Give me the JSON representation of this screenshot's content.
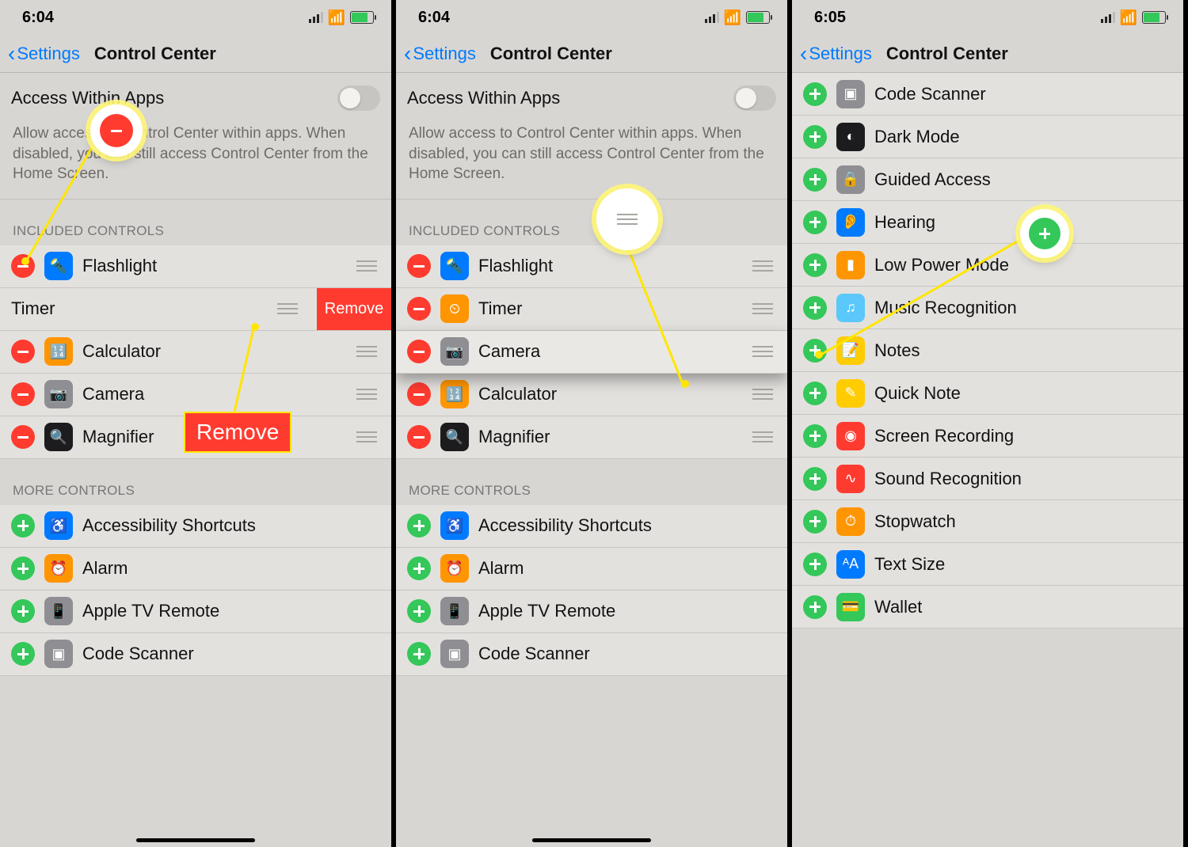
{
  "status": {
    "time_a": "6:04",
    "time_b": "6:04",
    "time_c": "6:05"
  },
  "nav": {
    "back": "Settings",
    "title": "Control Center"
  },
  "access": {
    "label": "Access Within Apps",
    "desc": "Allow access to Control Center within apps. When disabled, you can still access Control Center from the Home Screen."
  },
  "sections": {
    "included": "INCLUDED CONTROLS",
    "more": "MORE CONTROLS"
  },
  "phone1": {
    "included": [
      {
        "label": "Flashlight"
      },
      {
        "label": "Timer",
        "swiped": true,
        "remove": "Remove"
      },
      {
        "label": "Calculator"
      },
      {
        "label": "Camera"
      },
      {
        "label": "Magnifier"
      }
    ],
    "more": [
      {
        "label": "Accessibility Shortcuts"
      },
      {
        "label": "Alarm"
      },
      {
        "label": "Apple TV Remote"
      },
      {
        "label": "Code Scanner"
      }
    ],
    "callout_tag": "Remove"
  },
  "phone2": {
    "included": [
      {
        "label": "Flashlight"
      },
      {
        "label": "Timer"
      },
      {
        "label": "Camera",
        "dragging": true
      },
      {
        "label": "Calculator"
      },
      {
        "label": "Magnifier"
      }
    ],
    "more": [
      {
        "label": "Accessibility Shortcuts"
      },
      {
        "label": "Alarm"
      },
      {
        "label": "Apple TV Remote"
      },
      {
        "label": "Code Scanner"
      }
    ]
  },
  "phone3": {
    "more": [
      {
        "label": "Code Scanner"
      },
      {
        "label": "Dark Mode"
      },
      {
        "label": "Guided Access"
      },
      {
        "label": "Hearing"
      },
      {
        "label": "Low Power Mode"
      },
      {
        "label": "Music Recognition"
      },
      {
        "label": "Notes"
      },
      {
        "label": "Quick Note"
      },
      {
        "label": "Screen Recording"
      },
      {
        "label": "Sound Recognition"
      },
      {
        "label": "Stopwatch"
      },
      {
        "label": "Text Size"
      },
      {
        "label": "Wallet"
      }
    ]
  },
  "icons": {
    "Flashlight": {
      "glyph": "⚡",
      "bg": "bg-blue"
    },
    "Timer": {
      "glyph": "◷",
      "bg": "bg-orange"
    },
    "Calculator": {
      "glyph": "▦",
      "bg": "bg-orange"
    },
    "Camera": {
      "glyph": "◉",
      "bg": "bg-gray"
    },
    "Magnifier": {
      "glyph": "⌕",
      "bg": "bg-dark"
    },
    "Accessibility Shortcuts": {
      "glyph": "⦿",
      "bg": "bg-blue"
    },
    "Alarm": {
      "glyph": "⏰",
      "bg": "bg-orange"
    },
    "Apple TV Remote": {
      "glyph": "▭",
      "bg": "bg-gray"
    },
    "Code Scanner": {
      "glyph": "▣",
      "bg": "bg-gray"
    },
    "Dark Mode": {
      "glyph": "◐",
      "bg": "bg-dark"
    },
    "Guided Access": {
      "glyph": "🔒",
      "bg": "bg-gray"
    },
    "Hearing": {
      "glyph": "👂",
      "bg": "bg-blue"
    },
    "Low Power Mode": {
      "glyph": "▮",
      "bg": "bg-orange"
    },
    "Music Recognition": {
      "glyph": "♫",
      "bg": "bg-teal"
    },
    "Notes": {
      "glyph": "📝",
      "bg": "bg-yellow"
    },
    "Quick Note": {
      "glyph": "✎",
      "bg": "bg-yellow"
    },
    "Screen Recording": {
      "glyph": "◉",
      "bg": "bg-red"
    },
    "Sound Recognition": {
      "glyph": "∿",
      "bg": "bg-red"
    },
    "Stopwatch": {
      "glyph": "⏱",
      "bg": "bg-orange"
    },
    "Text Size": {
      "glyph": "ᴬA",
      "bg": "bg-blue"
    },
    "Wallet": {
      "glyph": "💳",
      "bg": "bg-green"
    }
  }
}
